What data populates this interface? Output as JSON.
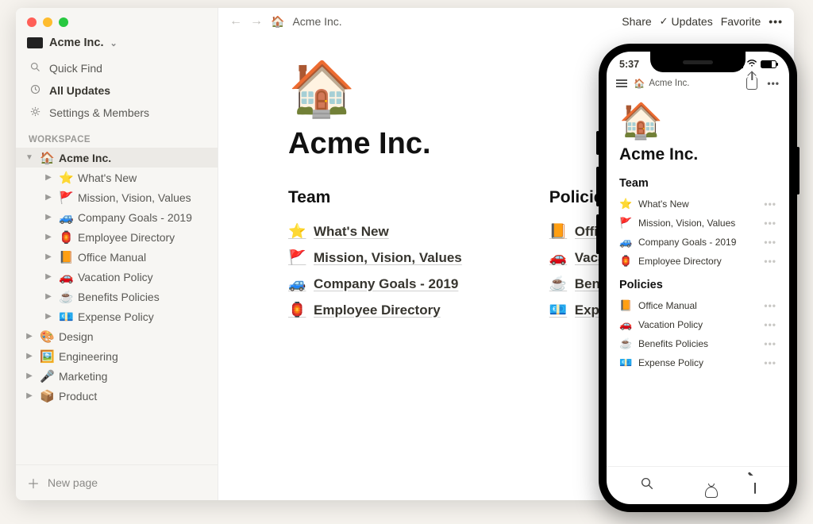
{
  "traffic_colors": {
    "red": "#ff5f57",
    "yellow": "#febc2e",
    "green": "#28c840"
  },
  "workspace": {
    "name": "Acme Inc.",
    "logo": "acme"
  },
  "sidebar": {
    "quick_find": "Quick Find",
    "all_updates": "All Updates",
    "settings": "Settings & Members",
    "section_label": "WORKSPACE",
    "tree": [
      {
        "emoji": "🏠",
        "label": "Acme Inc.",
        "expanded": true,
        "selected": true,
        "children": [
          {
            "emoji": "⭐",
            "label": "What's New"
          },
          {
            "emoji": "🚩",
            "label": "Mission, Vision, Values"
          },
          {
            "emoji": "🚙",
            "label": "Company Goals - 2019"
          },
          {
            "emoji": "🏮",
            "label": "Employee Directory"
          },
          {
            "emoji": "📙",
            "label": "Office Manual"
          },
          {
            "emoji": "🚗",
            "label": "Vacation Policy"
          },
          {
            "emoji": "☕",
            "label": "Benefits Policies"
          },
          {
            "emoji": "💶",
            "label": "Expense Policy"
          }
        ]
      },
      {
        "emoji": "🎨",
        "label": "Design"
      },
      {
        "emoji": "🖼️",
        "label": "Engineering"
      },
      {
        "emoji": "🎤",
        "label": "Marketing"
      },
      {
        "emoji": "📦",
        "label": "Product"
      }
    ],
    "new_page": "New page"
  },
  "topbar": {
    "breadcrumb_icon": "🏠",
    "breadcrumb": "Acme Inc.",
    "share": "Share",
    "updates": "Updates",
    "favorite": "Favorite"
  },
  "page": {
    "hero": "🏠",
    "title": "Acme Inc.",
    "sections": [
      {
        "heading": "Team",
        "items": [
          {
            "emoji": "⭐",
            "label": "What's New"
          },
          {
            "emoji": "🚩",
            "label": "Mission, Vision, Values"
          },
          {
            "emoji": "🚙",
            "label": "Company Goals - 2019"
          },
          {
            "emoji": "🏮",
            "label": "Employee Directory"
          }
        ]
      },
      {
        "heading": "Policies",
        "items": [
          {
            "emoji": "📙",
            "label": "Office Manual"
          },
          {
            "emoji": "🚗",
            "label": "Vacation Policy"
          },
          {
            "emoji": "☕",
            "label": "Benefits Policies"
          },
          {
            "emoji": "💶",
            "label": "Expense Policy"
          }
        ]
      }
    ]
  },
  "mobile": {
    "time": "5:37",
    "breadcrumb_icon": "🏠",
    "breadcrumb": "Acme Inc.",
    "hero": "🏠",
    "title": "Acme Inc.",
    "sections": [
      {
        "heading": "Team",
        "items": [
          {
            "emoji": "⭐",
            "label": "What's New"
          },
          {
            "emoji": "🚩",
            "label": "Mission, Vision, Values"
          },
          {
            "emoji": "🚙",
            "label": "Company Goals - 2019"
          },
          {
            "emoji": "🏮",
            "label": "Employee Directory"
          }
        ]
      },
      {
        "heading": "Policies",
        "items": [
          {
            "emoji": "📙",
            "label": "Office Manual"
          },
          {
            "emoji": "🚗",
            "label": "Vacation Policy"
          },
          {
            "emoji": "☕",
            "label": "Benefits Policies"
          },
          {
            "emoji": "💶",
            "label": "Expense Policy"
          }
        ]
      }
    ]
  }
}
